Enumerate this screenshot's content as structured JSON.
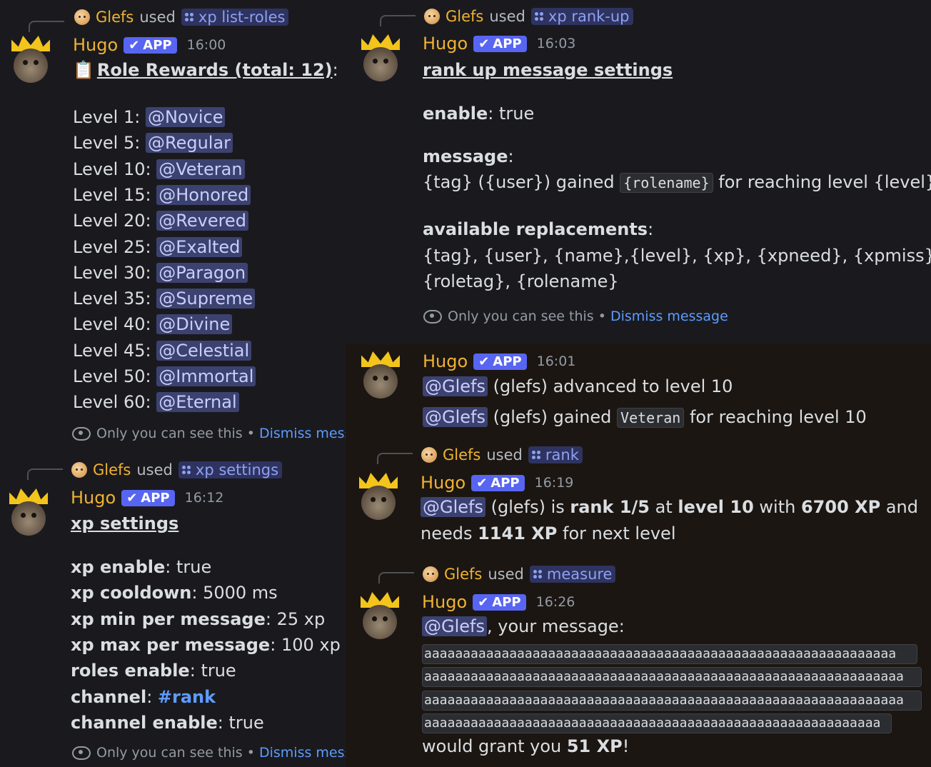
{
  "invoker": "Glefs",
  "used_word": "used",
  "bot_name": "Hugo",
  "app_badge": "APP",
  "only_you": "Only you can see this",
  "dot": "•",
  "dismiss": "Dismiss message",
  "msg1": {
    "command": "xp list-roles",
    "time": "16:00",
    "title": "Role Rewards (total: 12)",
    "title_suffix": ":",
    "clipboard_icon": "📋",
    "levels": [
      {
        "label": "Level 1:",
        "role": "@Novice"
      },
      {
        "label": "Level 5:",
        "role": "@Regular"
      },
      {
        "label": "Level 10:",
        "role": "@Veteran"
      },
      {
        "label": "Level 15:",
        "role": "@Honored"
      },
      {
        "label": "Level 20:",
        "role": "@Revered"
      },
      {
        "label": "Level 25:",
        "role": "@Exalted"
      },
      {
        "label": "Level 30:",
        "role": "@Paragon"
      },
      {
        "label": "Level 35:",
        "role": "@Supreme"
      },
      {
        "label": "Level 40:",
        "role": "@Divine"
      },
      {
        "label": "Level 45:",
        "role": "@Celestial"
      },
      {
        "label": "Level 50:",
        "role": "@Immortal"
      },
      {
        "label": "Level 60:",
        "role": "@Eternal"
      }
    ]
  },
  "msg2": {
    "command": "xp settings",
    "time": "16:12",
    "title": "xp settings",
    "rows": [
      {
        "key": "xp enable",
        "sep": ": ",
        "value": "true"
      },
      {
        "key": "xp cooldown",
        "sep": ": ",
        "value": "5000 ms"
      },
      {
        "key": "xp min per message",
        "sep": ": ",
        "value": "25 xp"
      },
      {
        "key": "xp max per message",
        "sep": ": ",
        "value": "100 xp"
      },
      {
        "key": "roles enable",
        "sep": ": ",
        "value": "true"
      },
      {
        "key": "channel",
        "sep": ": ",
        "value": "#rank"
      },
      {
        "key": "channel enable",
        "sep": ": ",
        "value": "true"
      }
    ]
  },
  "msg3": {
    "command": "xp rank-up",
    "time": "16:03",
    "title": "rank up message settings",
    "enable_key": "enable",
    "enable_val": ": true",
    "message_key": "message",
    "colon": ":",
    "message_pre": "{tag} ({user}) gained ",
    "message_code": "{rolename}",
    "message_post": " for reaching level {level}",
    "repl_key": "available replacements",
    "repl_line1": "{tag}, {user}, {name},{level}, {xp}, {xpneed}, {xpmiss},",
    "repl_line2": "{roletag}, {rolename}"
  },
  "msg4": {
    "time": "16:01",
    "mention": "@Glefs",
    "line1": " (glefs) advanced to level 10",
    "line2_pre": " (glefs) gained ",
    "line2_code": "Veteran",
    "line2_post": " for reaching level 10"
  },
  "msg5": {
    "command": "rank",
    "time": "16:19",
    "mention": "@Glefs",
    "t1": " (glefs) is ",
    "rank": "rank 1/5",
    "t2": " at ",
    "level": "level 10",
    "t3": " with ",
    "xp": "6700 XP",
    "t4": " and",
    "t5": "needs ",
    "need": "1141 XP",
    "t6": " for next level"
  },
  "msg6": {
    "command": "measure",
    "time": "16:26",
    "mention": "@Glefs",
    "after_mention": ", your message:",
    "code_lines": [
      "aaaaaaaaaaaaaaaaaaaaaaaaaaaaaaaaaaaaaaaaaaaaaaaaaaaaaaaaaaaaa",
      "aaaaaaaaaaaaaaaaaaaaaaaaaaaaaaaaaaaaaaaaaaaaaaaaaaaaaaaaaaaaaa",
      "aaaaaaaaaaaaaaaaaaaaaaaaaaaaaaaaaaaaaaaaaaaaaaaaaaaaaaaaaaaaaa",
      "aaaaaaaaaaaaaaaaaaaaaaaaaaaaaaaaaaaaaaaaaaaaaaaaaaaaaaaaaaa"
    ],
    "grant_pre": "would grant you ",
    "grant_xp": "51 XP",
    "grant_post": "!"
  },
  "colors": {
    "mention_bg": "#3c4270",
    "app_badge": "#5865f2",
    "username": "#f0b232",
    "link": "#5d9cff"
  }
}
